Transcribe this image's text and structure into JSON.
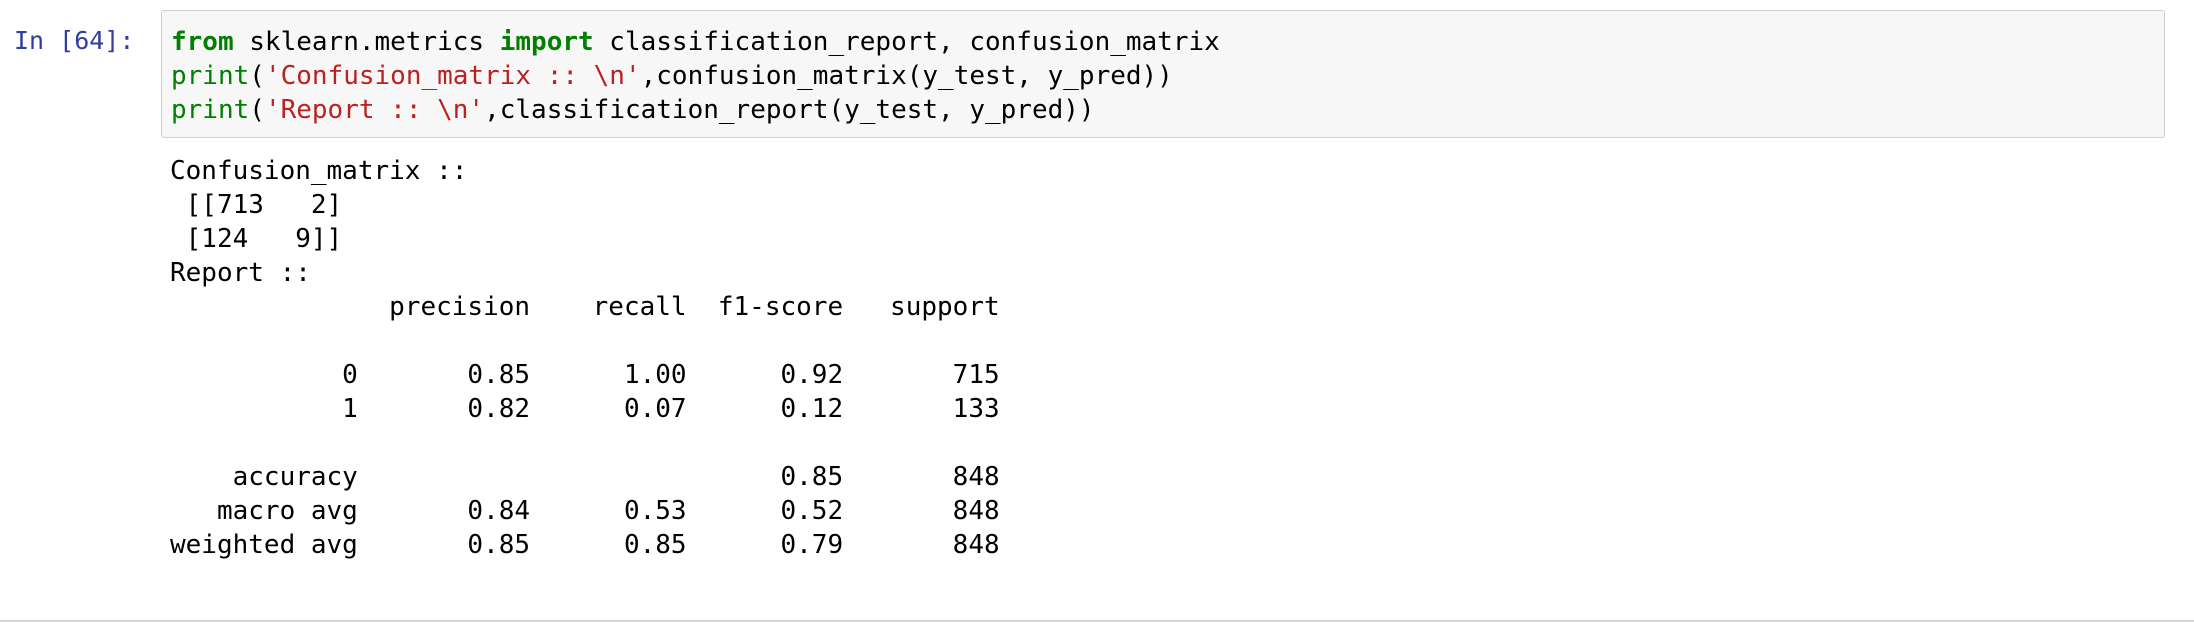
{
  "cell": {
    "prompt": "In [64]:",
    "code_lines": [
      [
        {
          "t": "from",
          "c": "kw"
        },
        {
          "t": " sklearn.metrics ",
          "c": ""
        },
        {
          "t": "import",
          "c": "kw"
        },
        {
          "t": " classification_report, confusion_matrix",
          "c": ""
        }
      ],
      [
        {
          "t": "print",
          "c": "bi"
        },
        {
          "t": "(",
          "c": ""
        },
        {
          "t": "'Confusion_matrix :: \\n'",
          "c": "str"
        },
        {
          "t": ",confusion_matrix(y_test, y_pred))",
          "c": ""
        }
      ],
      [
        {
          "t": "print",
          "c": "bi"
        },
        {
          "t": "(",
          "c": ""
        },
        {
          "t": "'Report :: \\n'",
          "c": "str"
        },
        {
          "t": ",classification_report(y_test, y_pred))",
          "c": ""
        }
      ]
    ],
    "output_lines": [
      "Confusion_matrix ::",
      " [[713   2]",
      " [124   9]]",
      "Report ::",
      "              precision    recall  f1-score   support",
      "",
      "           0       0.85      1.00      0.92       715",
      "           1       0.82      0.07      0.12       133",
      "",
      "    accuracy                           0.85       848",
      "   macro avg       0.84      0.53      0.52       848",
      "weighted avg       0.85      0.85      0.79       848"
    ]
  },
  "colors": {
    "prompt": "#303f9f",
    "keyword": "#008000",
    "string": "#ba2121",
    "input_background": "#f7f7f7",
    "input_border": "#cfcfcf"
  }
}
